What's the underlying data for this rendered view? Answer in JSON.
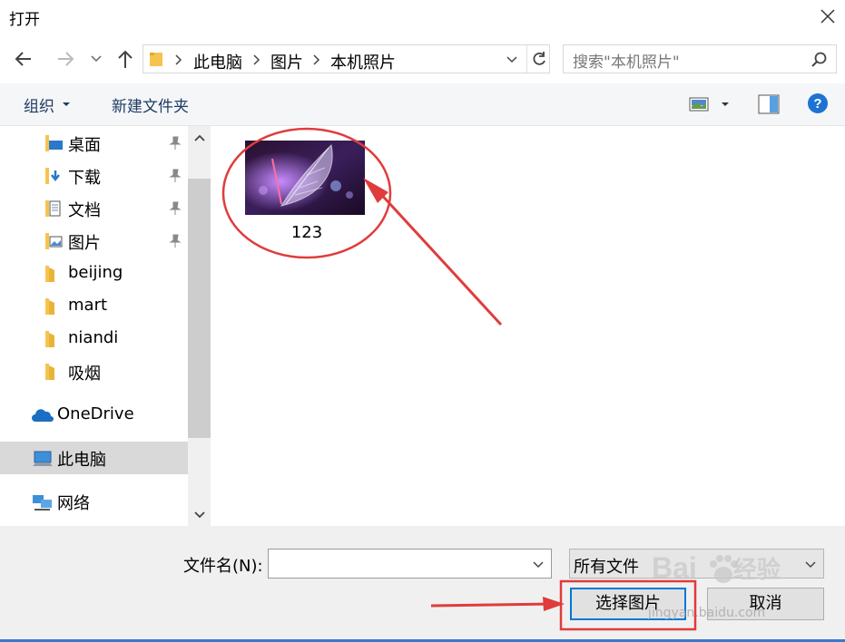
{
  "window": {
    "title": "打开"
  },
  "nav": {
    "breadcrumb": [
      "此电脑",
      "图片",
      "本机照片"
    ],
    "search_placeholder": "搜索\"本机照片\""
  },
  "toolbar": {
    "organize": "组织",
    "new_folder": "新建文件夹"
  },
  "sidebar": {
    "items": [
      {
        "label": "桌面",
        "icon": "desktop-folder-icon",
        "pinned": true
      },
      {
        "label": "下载",
        "icon": "download-folder-icon",
        "pinned": true
      },
      {
        "label": "文档",
        "icon": "documents-folder-icon",
        "pinned": true
      },
      {
        "label": "图片",
        "icon": "pictures-folder-icon",
        "pinned": true
      },
      {
        "label": "beijing",
        "icon": "folder-icon",
        "pinned": false
      },
      {
        "label": "mart",
        "icon": "folder-icon",
        "pinned": false
      },
      {
        "label": "niandi",
        "icon": "folder-icon",
        "pinned": false
      },
      {
        "label": "吸烟",
        "icon": "folder-icon",
        "pinned": false
      },
      {
        "label": "OneDrive",
        "icon": "onedrive-cloud-icon",
        "pinned": false
      },
      {
        "label": "此电脑",
        "icon": "computer-icon",
        "pinned": false,
        "selected": true
      },
      {
        "label": "网络",
        "icon": "network-icon",
        "pinned": false
      }
    ]
  },
  "files": [
    {
      "name": "123",
      "type": "image"
    }
  ],
  "footer": {
    "filename_label": "文件名(N):",
    "filename_value": "",
    "filetype_value": "所有文件",
    "open_button": "选择图片",
    "cancel_button": "取消"
  },
  "watermark": {
    "brand": "Bai",
    "brand2": "经验",
    "url": "jingyan.baidu.com"
  },
  "colors": {
    "accent": "#0078d7",
    "annotation": "#e03c3c",
    "help": "#1e73d2"
  }
}
